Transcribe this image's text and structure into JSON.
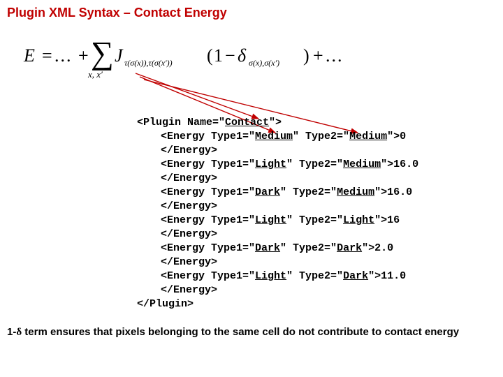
{
  "title": "Plugin XML Syntax – Contact Energy",
  "formula": {
    "E": "E",
    "eq": "=",
    "dots1": "...",
    "plus1": "+",
    "sigma": "∑",
    "sumsub": "x, x′",
    "J": "J",
    "Jsub": "τ(σ(x)),τ(σ(x′))",
    "lpar": "(",
    "one": "1",
    "minus": "−",
    "delta": "δ",
    "dsub": "σ(x),σ(x′)",
    "rpar": ")",
    "plus2": "+",
    "dots2": "..."
  },
  "code": {
    "open": "<Plugin Name=\"",
    "name": "Contact",
    "open_end": "\">",
    "lines": [
      {
        "a": "<Energy Type1=\"",
        "t1": "Medium",
        "b": "\" Type2=\"",
        "t2": "Medium",
        "c": "\">",
        "v": "0"
      },
      {
        "a": "<Energy Type1=\"",
        "t1": "Light",
        "b": "\" Type2=\"",
        "t2": "Medium",
        "c": "\">",
        "v": "16.0"
      },
      {
        "a": "<Energy Type1=\"",
        "t1": "Dark",
        "b": "\" Type2=\"",
        "t2": "Medium",
        "c": "\">",
        "v": "16.0"
      },
      {
        "a": "<Energy Type1=\"",
        "t1": "Light",
        "b": "\" Type2=\"",
        "t2": "Light",
        "c": "\">",
        "v": "16"
      },
      {
        "a": "<Energy Type1=\"",
        "t1": "Dark",
        "b": "\" Type2=\"",
        "t2": "Dark",
        "c": "\">",
        "v": "2.0"
      },
      {
        "a": "<Energy Type1=\"",
        "t1": "Light",
        "b": "\" Type2=\"",
        "t2": "Dark",
        "c": "\">",
        "v": "11.0"
      }
    ],
    "close_energy": "</Energy>",
    "close": "</Plugin>"
  },
  "footer": {
    "pre": "1-",
    "delta": "δ",
    "post": " term ensures that pixels belonging to the same cell do not contribute to contact energy"
  }
}
